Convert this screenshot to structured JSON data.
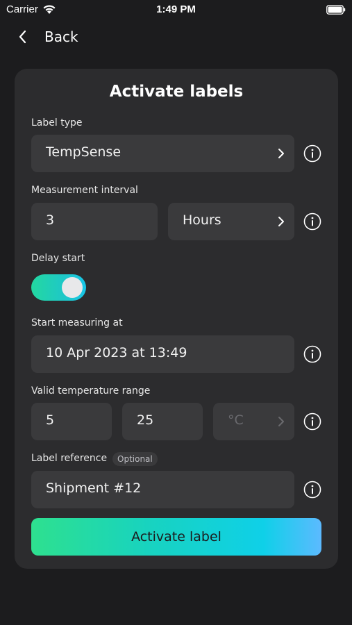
{
  "status_bar": {
    "carrier": "Carrier",
    "time": "1:49 PM"
  },
  "nav": {
    "back_label": "Back"
  },
  "form": {
    "title": "Activate labels",
    "label_type": {
      "label": "Label type",
      "value": "TempSense"
    },
    "measurement_interval": {
      "label": "Measurement interval",
      "value": "3",
      "unit": "Hours"
    },
    "delay_start": {
      "label": "Delay start",
      "enabled": true
    },
    "start_measuring": {
      "label": "Start measuring at",
      "value": "10 Apr 2023 at 13:49"
    },
    "temperature_range": {
      "label": "Valid temperature range",
      "min": "5",
      "max": "25",
      "unit": "°C"
    },
    "label_reference": {
      "label": "Label reference",
      "optional": "Optional",
      "value": "Shipment #12"
    },
    "submit_label": "Activate label"
  },
  "colors": {
    "background": "#1c1c1e",
    "card": "#2c2c2e",
    "field": "#3a3a3c",
    "accent_green": "#2ee08f",
    "accent_cyan": "#0fd0e8"
  },
  "icons": [
    "wifi-icon",
    "battery-icon",
    "chevron-left-icon",
    "chevron-right-icon",
    "info-icon"
  ]
}
